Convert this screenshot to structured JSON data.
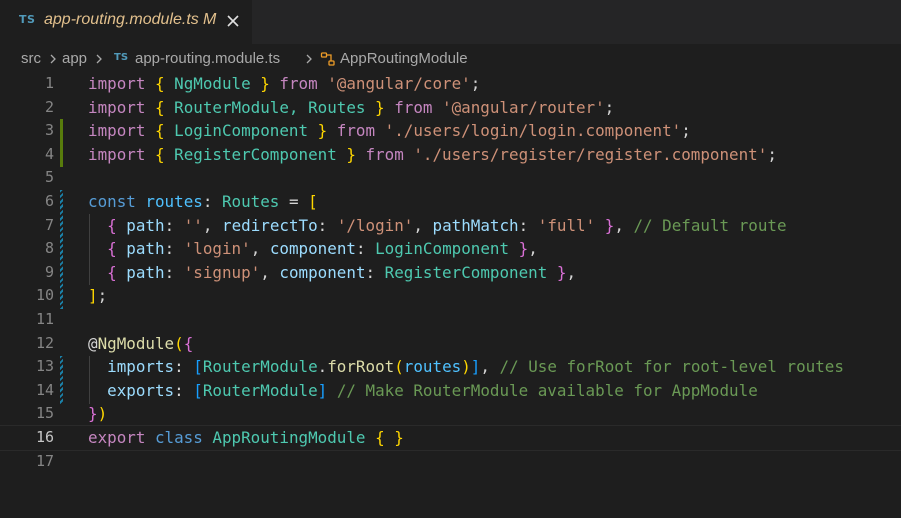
{
  "tab": {
    "lang_badge": "TS",
    "title": "app-routing.module.ts",
    "modified": "M"
  },
  "breadcrumb": {
    "seg1": "src",
    "seg2": "app",
    "file_badge": "TS",
    "file": "app-routing.module.ts",
    "symbol": "AppRoutingModule"
  },
  "editor": {
    "current_line": 16,
    "lines": [
      {
        "n": "1"
      },
      {
        "n": "2"
      },
      {
        "n": "3"
      },
      {
        "n": "4"
      },
      {
        "n": "5"
      },
      {
        "n": "6"
      },
      {
        "n": "7"
      },
      {
        "n": "8"
      },
      {
        "n": "9"
      },
      {
        "n": "10"
      },
      {
        "n": "11"
      },
      {
        "n": "12"
      },
      {
        "n": "13"
      },
      {
        "n": "14"
      },
      {
        "n": "15"
      },
      {
        "n": "16"
      },
      {
        "n": "17"
      }
    ],
    "tokens": {
      "l1": [
        "import",
        " ",
        "{",
        " NgModule ",
        "}",
        " from ",
        "'@angular/core'",
        ";"
      ],
      "l2": [
        "import",
        " ",
        "{",
        " RouterModule, Routes ",
        "}",
        " from ",
        "'@angular/router'",
        ";"
      ],
      "l3": [
        "import",
        " ",
        "{",
        " LoginComponent ",
        "}",
        " from ",
        "'./users/login/login.component'",
        ";"
      ],
      "l4": [
        "import",
        " ",
        "{",
        " RegisterComponent ",
        "}",
        " from ",
        "'./users/register/register.component'",
        ";"
      ],
      "l6": [
        "const",
        " ",
        "routes",
        ": ",
        "Routes",
        " = ",
        "["
      ],
      "l7": [
        "  ",
        "{",
        " ",
        "path",
        ": ",
        "''",
        ", ",
        "redirectTo",
        ": ",
        "'/login'",
        ", ",
        "pathMatch",
        ": ",
        "'full'",
        " ",
        "}",
        ", ",
        "// Default route"
      ],
      "l8": [
        "  ",
        "{",
        " ",
        "path",
        ": ",
        "'login'",
        ", ",
        "component",
        ": ",
        "LoginComponent",
        " ",
        "}",
        ","
      ],
      "l9": [
        "  ",
        "{",
        " ",
        "path",
        ": ",
        "'signup'",
        ", ",
        "component",
        ": ",
        "RegisterComponent",
        " ",
        "}",
        ","
      ],
      "l10": [
        "]",
        ";"
      ],
      "l12": [
        "@",
        "NgModule",
        "(",
        "{"
      ],
      "l13": [
        "  ",
        "imports",
        ": ",
        "[",
        "RouterModule",
        ".",
        "forRoot",
        "(",
        "routes",
        ")",
        "]",
        ", ",
        "// Use forRoot for root-level routes"
      ],
      "l14": [
        "  ",
        "exports",
        ": ",
        "[",
        "RouterModule",
        "]",
        " ",
        "// Make RouterModule available for AppModule"
      ],
      "l15": [
        "}",
        ")"
      ],
      "l16": [
        "export",
        " ",
        "class",
        " ",
        "AppRoutingModule",
        " ",
        "{",
        " ",
        "}"
      ]
    }
  },
  "colors": {
    "background": "#1e1e1e",
    "keyword_control": "#c586c0",
    "string": "#ce9178",
    "type": "#4ec9b0",
    "comment": "#6a9955",
    "git_added": "#587c0c",
    "git_modified": "#1b81a8"
  },
  "icons": [
    "close-icon",
    "chevron-right-icon",
    "module-symbol-icon"
  ]
}
